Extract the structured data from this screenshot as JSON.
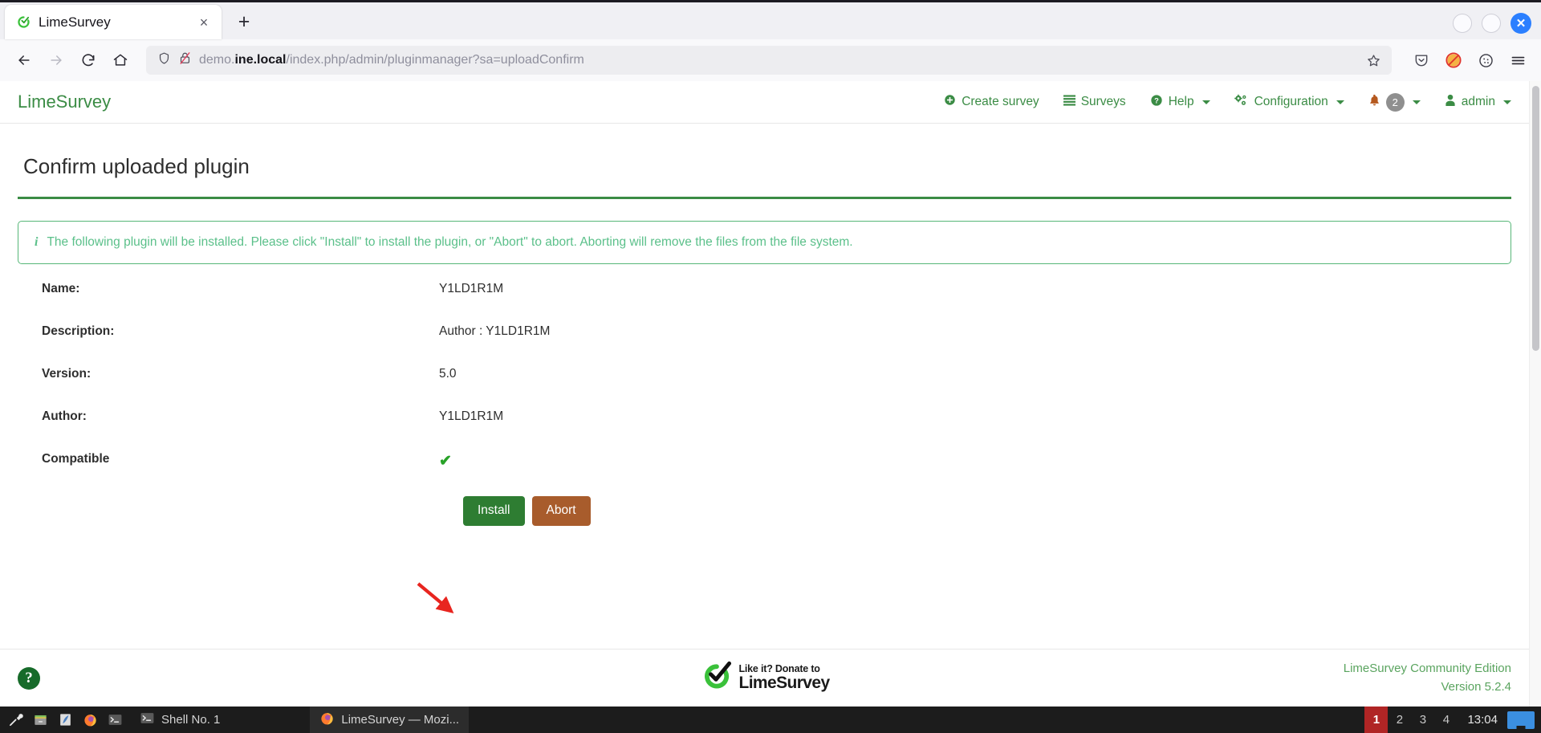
{
  "browser": {
    "tab": {
      "title": "LimeSurvey",
      "favicon": "limesurvey-favicon",
      "close_label": "×"
    },
    "newtab_label": "+",
    "window_controls": {
      "minimize": "minimize-circle",
      "maximize": "maximize-circle",
      "close": "✕"
    },
    "nav": {
      "back": "←",
      "forward": "→",
      "reload": "⟳",
      "home": "⌂"
    },
    "url": {
      "domain_prefix": "demo.",
      "domain_bold": "ine.local",
      "path": "/index.php/admin/pluginmanager?sa=uploadConfirm",
      "full": "demo.ine.local/index.php/admin/pluginmanager?sa=uploadConfirm"
    }
  },
  "app": {
    "brand": "LimeSurvey",
    "nav": [
      {
        "label": "Create survey",
        "icon": "plus-circle-icon",
        "caret": false
      },
      {
        "label": "Surveys",
        "icon": "list-icon",
        "caret": false
      },
      {
        "label": "Help",
        "icon": "question-circle-icon",
        "caret": true
      },
      {
        "label": "Configuration",
        "icon": "gears-icon",
        "caret": true
      }
    ],
    "notifications": {
      "icon": "bell-icon",
      "count": "2"
    },
    "user": {
      "label": "admin",
      "icon": "user-icon"
    }
  },
  "main": {
    "title": "Confirm uploaded plugin",
    "alert": {
      "icon": "info-icon",
      "text": "The following plugin will be installed. Please click \"Install\" to install the plugin, or \"Abort\" to abort. Aborting will remove the files from the file system."
    },
    "details": [
      {
        "label": "Name:",
        "value": "Y1LD1R1M"
      },
      {
        "label": "Description:",
        "value": "Author : Y1LD1R1M"
      },
      {
        "label": "Version:",
        "value": "5.0"
      },
      {
        "label": "Author:",
        "value": "Y1LD1R1M"
      },
      {
        "label": "Compatible",
        "value": "✔"
      }
    ],
    "buttons": {
      "install": "Install",
      "abort": "Abort"
    },
    "annotation": {
      "type": "red-arrow",
      "points_to": "install-button"
    }
  },
  "footer": {
    "help_icon": "question-mark-icon",
    "donate_line1": "Like it? Donate to",
    "donate_line2": "LimeSurvey",
    "edition": "LimeSurvey Community Edition",
    "version": "Version 5.2.4"
  },
  "taskbar": {
    "icons": [
      "tools-icon",
      "files-icon",
      "editor-icon",
      "firefox-icon",
      "terminal-icon"
    ],
    "tasks": [
      {
        "label": "Shell No. 1",
        "icon": "terminal-icon",
        "active": false
      },
      {
        "label": "LimeSurvey — Mozi...",
        "icon": "firefox-icon",
        "active": true
      }
    ],
    "desktops": [
      {
        "label": "1",
        "active": true
      },
      {
        "label": "2",
        "active": false
      },
      {
        "label": "3",
        "active": false
      },
      {
        "label": "4",
        "active": false
      }
    ],
    "clock": "13:04"
  },
  "colors": {
    "brand_green": "#3b8c45",
    "install_green": "#2e7d32",
    "abort_brown": "#a85c2c",
    "alert_green": "#5bc08a",
    "arrow_red": "#e8251f"
  }
}
